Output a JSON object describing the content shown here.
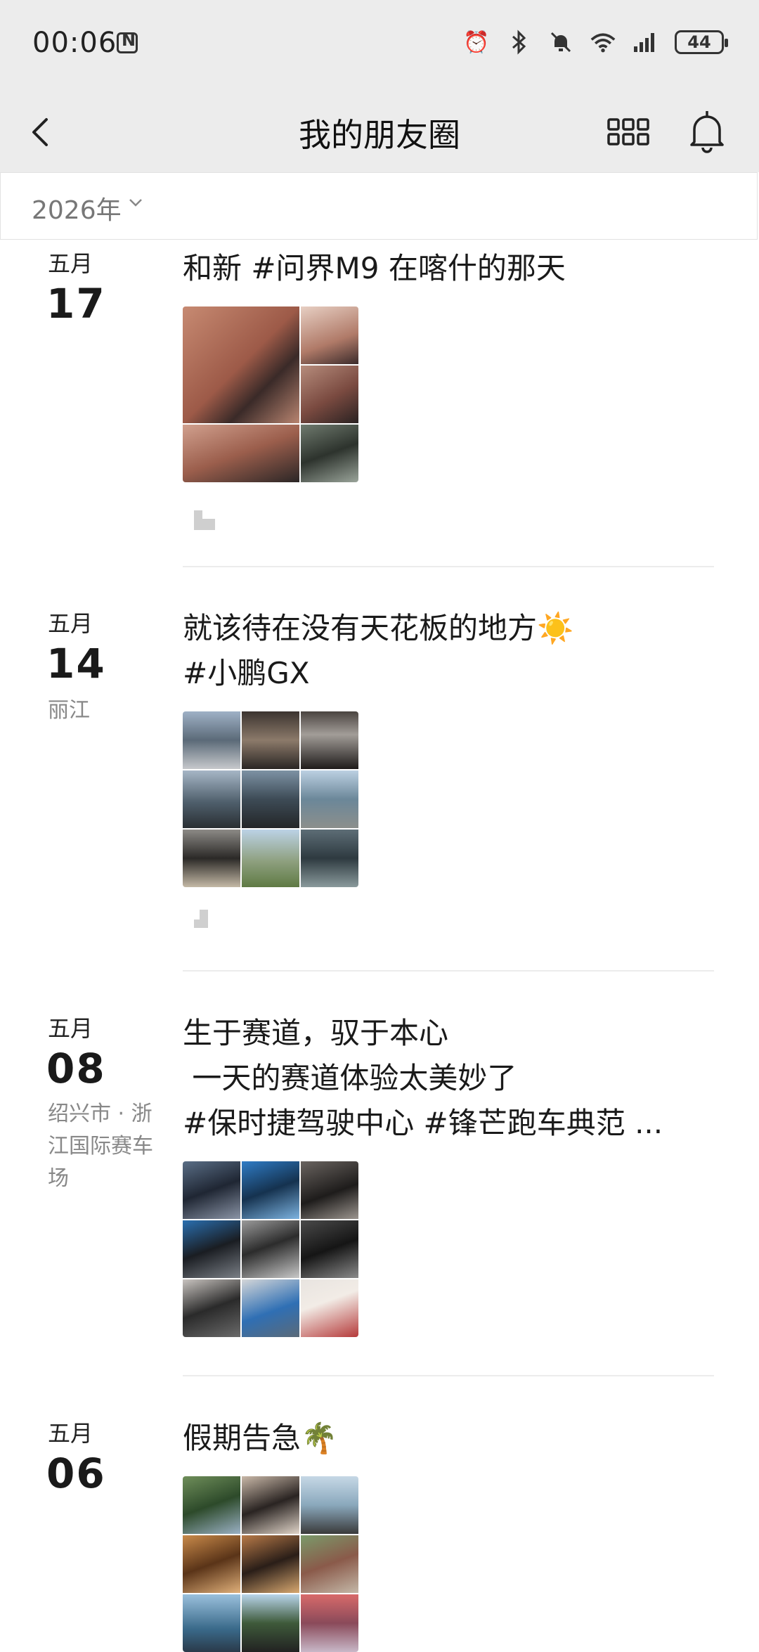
{
  "status": {
    "time": "00:06",
    "battery": "44"
  },
  "nav": {
    "title": "我的朋友圈"
  },
  "filter": {
    "year": "2026年"
  },
  "posts": [
    {
      "month": "五月",
      "day": "17",
      "location": "",
      "lines": [
        "和新 #问界M9 在喀什的那天"
      ]
    },
    {
      "month": "五月",
      "day": "14",
      "location": "丽江",
      "lines": [
        "就该待在没有天花板的地方☀️",
        "#小鹏GX"
      ]
    },
    {
      "month": "五月",
      "day": "08",
      "location": "绍兴市 · 浙江国际赛车场",
      "lines": [
        "生于赛道，驭于本心",
        " 一天的赛道体验太美妙了",
        "#保时捷驾驶中心 #锋芒跑车典范 ..."
      ]
    },
    {
      "month": "五月",
      "day": "06",
      "location": "",
      "lines": [
        "假期告急🌴"
      ]
    }
  ],
  "colors": {
    "header_bg": "#ececec",
    "separator": "#ececec"
  }
}
